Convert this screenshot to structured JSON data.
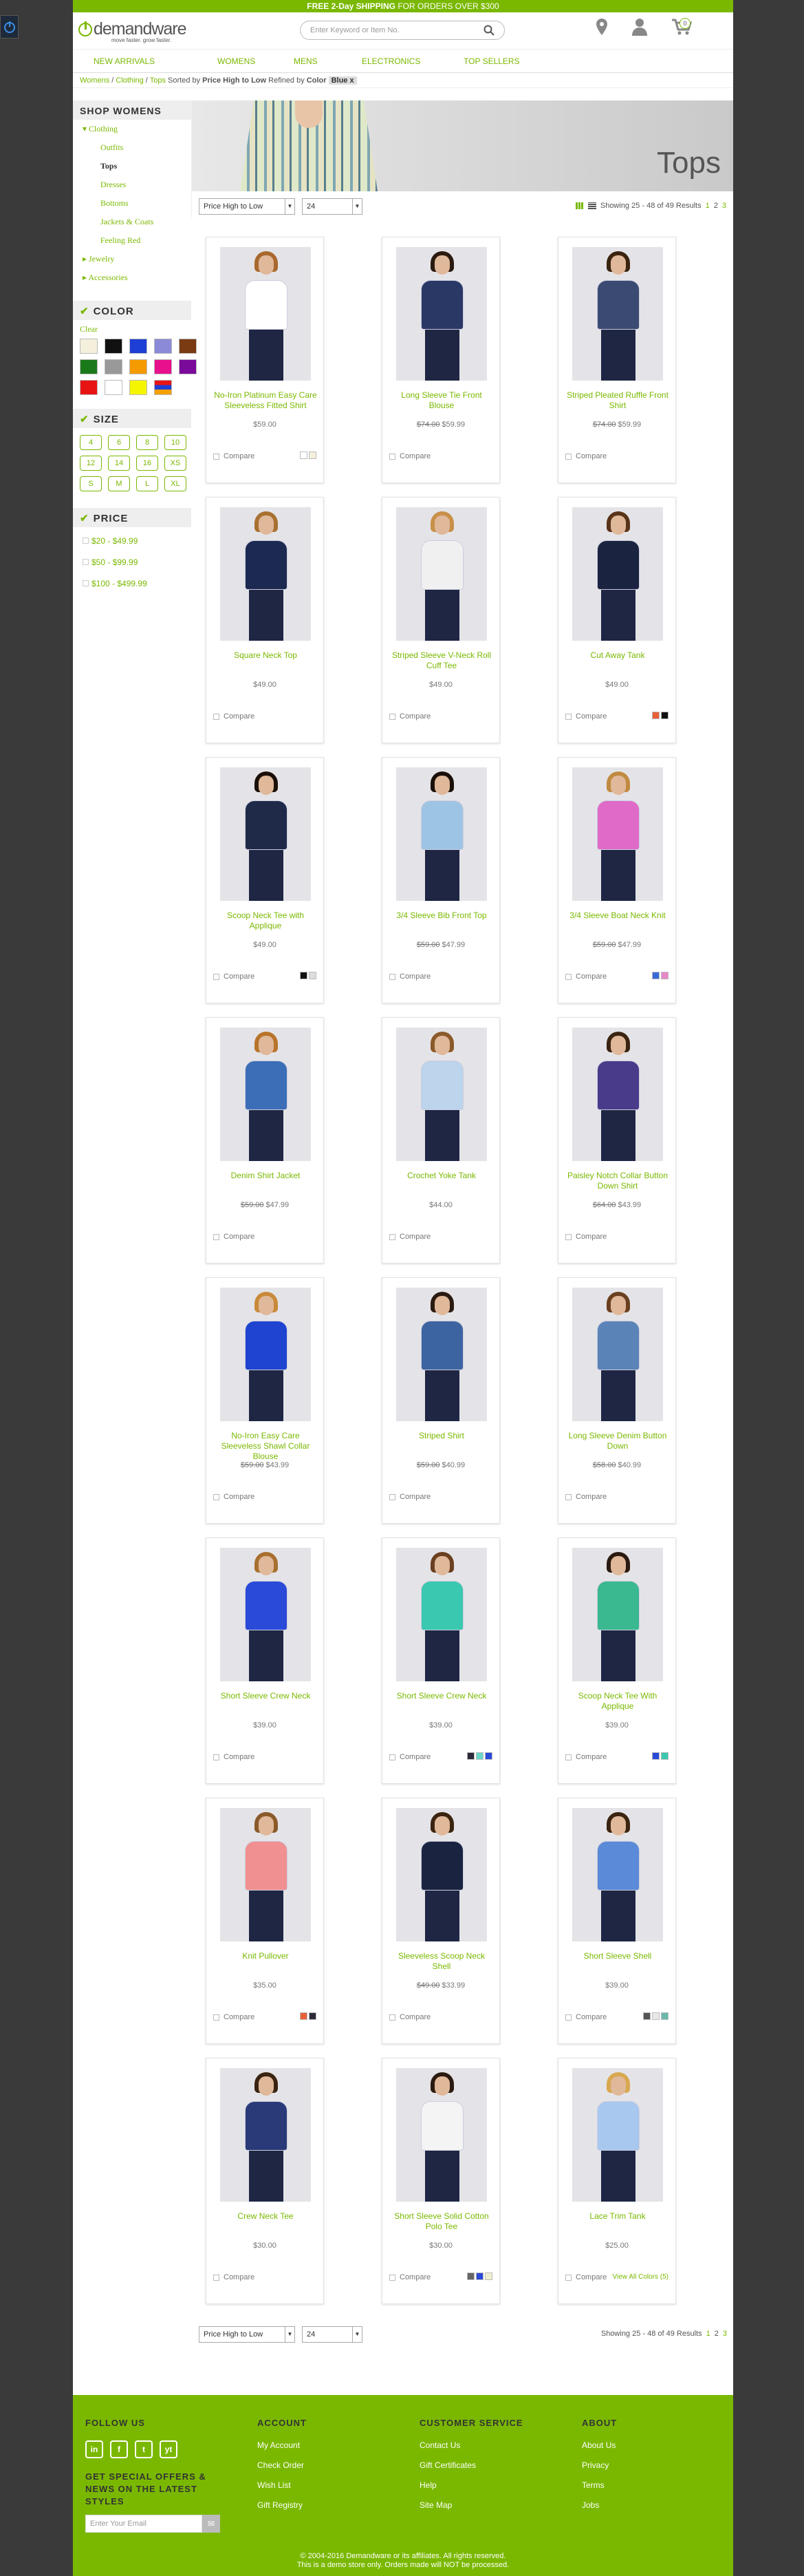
{
  "promo": {
    "bold": "FREE 2-Day SHIPPING",
    "rest": " FOR ORDERS OVER $300"
  },
  "logo": {
    "name": "demandware",
    "tagline": "move faster. grow faster."
  },
  "search": {
    "placeholder": "Enter Keyword or Item No."
  },
  "cart": {
    "count": "0"
  },
  "nav": [
    "NEW ARRIVALS",
    "WOMENS",
    "MENS",
    "ELECTRONICS",
    "TOP SELLERS"
  ],
  "breadcrumb": {
    "items": [
      "Womens",
      "Clothing",
      "Tops"
    ],
    "sorted_label": " Sorted by ",
    "sort_value": "Price High to Low",
    "refined_label": " Refined by ",
    "refine_attr": "Color",
    "refine_value": "Blue",
    "chip_close": "x"
  },
  "sidebar": {
    "title": "SHOP WOMENS",
    "categories": [
      {
        "label": "Clothing",
        "level": 1,
        "prefix": "▾"
      },
      {
        "label": "Outfits",
        "level": 2
      },
      {
        "label": "Tops",
        "level": 2,
        "active": true
      },
      {
        "label": "Dresses",
        "level": 2
      },
      {
        "label": "Bottoms",
        "level": 2
      },
      {
        "label": "Jackets & Coats",
        "level": 2
      },
      {
        "label": "Feeling Red",
        "level": 2
      },
      {
        "label": "Jewelry",
        "level": 1,
        "prefix": "▸"
      },
      {
        "label": "Accessories",
        "level": 1,
        "prefix": "▸"
      }
    ],
    "color_title": "COLOR",
    "color_clear": "Clear",
    "colors": [
      "#f5f0dc",
      "#111111",
      "#1e3fd6",
      "#8a8ad8",
      "#7a3a12",
      "#1a7a1a",
      "#999999",
      "#f59a00",
      "#e8108c",
      "#7a0a9a",
      "#e81414",
      "#ffffff",
      "#f5f500",
      "multi"
    ],
    "size_title": "SIZE",
    "sizes": [
      "4",
      "6",
      "8",
      "10",
      "12",
      "14",
      "16",
      "XS",
      "S",
      "M",
      "L",
      "XL"
    ],
    "price_title": "PRICE",
    "prices": [
      "$20 - $49.99",
      "$50 - $99.99",
      "$100 - $499.99"
    ]
  },
  "banner": {
    "title": "Tops"
  },
  "toolbar": {
    "sort": "Price High to Low",
    "per_page": "24",
    "showing": "Showing 25 - 48 of 49 Results",
    "pages": [
      "1",
      "2",
      "3"
    ]
  },
  "products": [
    {
      "name": "No-Iron Platinum Easy Care Sleeveless Fitted Shirt",
      "price": "$59.00",
      "old": "",
      "top": "#ffffff",
      "hair": "#a8682e",
      "colors": [
        "#ffffff",
        "#f5f0dc"
      ]
    },
    {
      "name": "Long Sleeve Tie Front Blouse",
      "price": "$59.99",
      "old": "$74.00",
      "top": "#2a3866",
      "hair": "#2a1a10",
      "colors": []
    },
    {
      "name": "Striped Pleated Ruffle Front Shirt",
      "price": "$59.99",
      "old": "$74.00",
      "top": "#3a4a72",
      "hair": "#3a2410",
      "colors": []
    },
    {
      "name": "Square Neck Top",
      "price": "$49.00",
      "old": "",
      "top": "#1c2a52",
      "hair": "#a87030",
      "colors": []
    },
    {
      "name": "Striped Sleeve V-Neck Roll Cuff Tee",
      "price": "$49.00",
      "old": "",
      "top": "#f0f0f0",
      "hair": "#c89048",
      "colors": []
    },
    {
      "name": "Cut Away Tank",
      "price": "$49.00",
      "old": "",
      "top": "#1a2440",
      "hair": "#5a3418",
      "colors": [
        "#e8603a",
        "#111111"
      ]
    },
    {
      "name": "Scoop Neck Tee with Applique",
      "price": "$49.00",
      "old": "",
      "top": "#1e2a48",
      "hair": "#1a1008",
      "colors": [
        "#111111",
        "#dddddd"
      ]
    },
    {
      "name": "3/4 Sleeve Bib Front Top",
      "price": "$47.99",
      "old": "$59.00",
      "top": "#9ec4e4",
      "hair": "#1a1008",
      "colors": []
    },
    {
      "name": "3/4 Sleeve Boat Neck Knit",
      "price": "$47.99",
      "old": "$59.00",
      "top": "#e06ac8",
      "hair": "#c08a40",
      "colors": [
        "#3a6ad8",
        "#e888c8"
      ]
    },
    {
      "name": "Denim Shirt Jacket",
      "price": "$47.99",
      "old": "$59.00",
      "top": "#3c6eb8",
      "hair": "#b8742a",
      "colors": []
    },
    {
      "name": "Crochet Yoke Tank",
      "price": "$44.00",
      "old": "",
      "top": "#bcd4ec",
      "hair": "#8a5a2a",
      "colors": []
    },
    {
      "name": "Paisley Notch Collar Button Down Shirt",
      "price": "$43.99",
      "old": "$64.00",
      "top": "#4a3a8a",
      "hair": "#3a2410",
      "colors": []
    },
    {
      "name": "No-Iron Easy Care Sleeveless Shawl Collar Blouse",
      "price": "$43.99",
      "old": "$59.00",
      "top": "#1e44d0",
      "hair": "#c88a3a",
      "colors": []
    },
    {
      "name": "Striped Shirt",
      "price": "$40.99",
      "old": "$59.00",
      "top": "#3c64a0",
      "hair": "#2a1a10",
      "colors": []
    },
    {
      "name": "Long Sleeve Denim Button Down",
      "price": "$40.99",
      "old": "$58.00",
      "top": "#5a84b8",
      "hair": "#6a4020",
      "colors": []
    },
    {
      "name": "Short Sleeve Crew Neck",
      "price": "$39.00",
      "old": "",
      "top": "#2a4ad8",
      "hair": "#a87030",
      "colors": []
    },
    {
      "name": "Short Sleeve Crew Neck",
      "price": "$39.00",
      "old": "",
      "top": "#3ac8b0",
      "hair": "#6a4020",
      "colors": [
        "#2a2a3a",
        "#6ad8c8",
        "#2a4ad8"
      ]
    },
    {
      "name": "Scoop Neck Tee With Applique",
      "price": "$39.00",
      "old": "",
      "top": "#3ab890",
      "hair": "#2a1a10",
      "colors": [
        "#2a4ad8",
        "#3ac8b0"
      ]
    },
    {
      "name": "Knit Pullover",
      "price": "$35.00",
      "old": "",
      "top": "#f09090",
      "hair": "#8a5a2a",
      "colors": [
        "#e8603a",
        "#2a2a3a"
      ]
    },
    {
      "name": "Sleeveless Scoop Neck Shell",
      "price": "$33.99",
      "old": "$49.00",
      "top": "#1a2440",
      "hair": "#3a2410",
      "colors": []
    },
    {
      "name": "Short Sleeve Shell",
      "price": "$39.00",
      "old": "",
      "top": "#5a8ad8",
      "hair": "#3a2410",
      "colors": [
        "#555555",
        "#e8e8e8",
        "#6ab8a8"
      ]
    },
    {
      "name": "Crew Neck Tee",
      "price": "$30.00",
      "old": "",
      "top": "#2a3a78",
      "hair": "#3a2410",
      "colors": []
    },
    {
      "name": "Short Sleeve Solid Cotton Polo Tee",
      "price": "$30.00",
      "old": "",
      "top": "#f4f4f4",
      "hair": "#2a1a10",
      "colors": [
        "#666666",
        "#2a4ad8",
        "#f0f0d0"
      ]
    },
    {
      "name": "Lace Trim Tank",
      "price": "$25.00",
      "old": "",
      "top": "#a8c8f0",
      "hair": "#d8a850",
      "colors": [],
      "all_colors": "View All Colors (5)"
    }
  ],
  "compare_label": "Compare",
  "footer": {
    "follow_title": "FOLLOW US",
    "social": [
      "in",
      "f",
      "t",
      "yt"
    ],
    "offers": "GET SPECIAL OFFERS & NEWS ON THE LATEST STYLES",
    "email_placeholder": "Enter Your Email",
    "account_title": "ACCOUNT",
    "account_links": [
      "My Account",
      "Check Order",
      "Wish List",
      "Gift Registry"
    ],
    "service_title": "CUSTOMER SERVICE",
    "service_links": [
      "Contact Us",
      "Gift Certificates",
      "Help",
      "Site Map"
    ],
    "about_title": "ABOUT",
    "about_links": [
      "About Us",
      "Privacy",
      "Terms",
      "Jobs"
    ],
    "copyright": "© 2004-2016 Demandware or its affiliates. All rights reserved.",
    "demo": "This is a demo store only. Orders made will NOT be processed."
  }
}
